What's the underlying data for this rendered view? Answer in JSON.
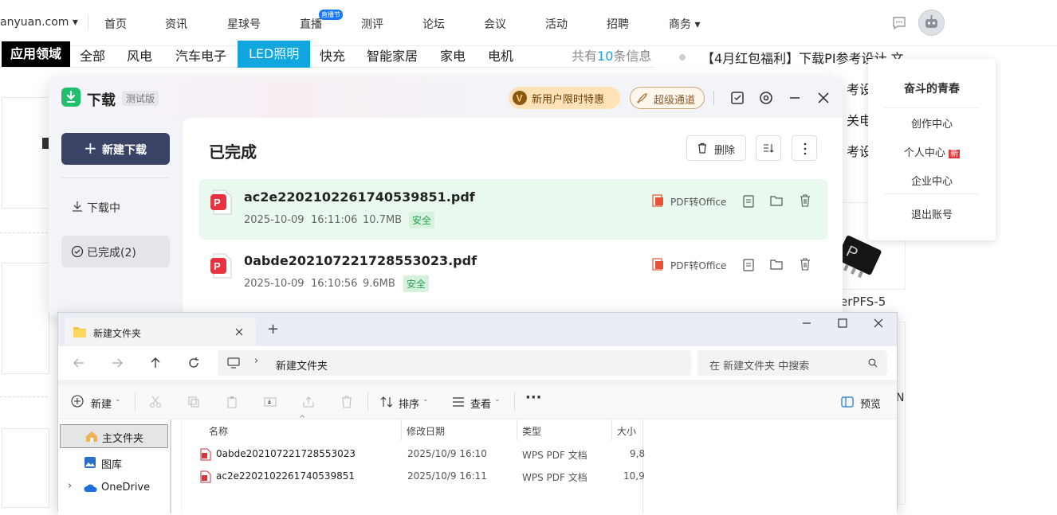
{
  "site": {
    "domain": "anyuan.com",
    "nav": [
      "首页",
      "资讯",
      "星球号",
      "直播",
      "测评",
      "论坛",
      "会议",
      "活动",
      "招聘",
      "商务"
    ],
    "live_badge": "直播节",
    "section_head": "应用领域",
    "categories": [
      "全部",
      "风电",
      "汽车电子",
      "LED照明",
      "快充",
      "智能家居",
      "家电",
      "电机"
    ],
    "selected_category": "LED照明",
    "count_prefix": "共有",
    "count_value": "10",
    "count_suffix": "条信息",
    "news": [
      "【4月红包福利】下载PI参考设计 文",
      "考设",
      "关电",
      "考设"
    ],
    "product_label": "erPFS-5",
    "edge_letter": "N"
  },
  "user_menu": {
    "username": "奋斗的青春",
    "items": [
      "创作中心",
      "个人中心",
      "企业中心",
      "退出账号"
    ],
    "new_badge": "新"
  },
  "downloader": {
    "title": "下载",
    "beta_tag": "测试版",
    "promo": "新用户限时特惠",
    "super_channel": "超级通道",
    "new_download": "新建下载",
    "side_downloading": "下载中",
    "side_completed": "已完成(2)",
    "heading": "已完成",
    "delete_label": "删除",
    "files": [
      {
        "name": "ac2e2202102261740539851.pdf",
        "date": "2025-10-09",
        "time": "16:11:06",
        "size": "10.7MB",
        "badge": "安全",
        "action": "PDF转Office"
      },
      {
        "name": "0abde202107221728553023.pdf",
        "date": "2025-10-09",
        "time": "16:10:56",
        "size": "9.6MB",
        "badge": "安全",
        "action": "PDF转Office"
      }
    ],
    "colors": {
      "accent": "#2e3a63",
      "highlight_row": "#e9f9ee",
      "safe": "#27a34f",
      "promo_bg": "#ffe2b7"
    }
  },
  "explorer": {
    "tab_title": "新建文件夹",
    "breadcrumb": "新建文件夹",
    "search_placeholder": "在 新建文件夹 中搜索",
    "cmd_new": "新建",
    "cmd_sort": "排序",
    "cmd_view": "查看",
    "cmd_preview": "预览",
    "nav_items": [
      "主文件夹",
      "图库",
      "OneDrive"
    ],
    "columns": [
      "名称",
      "修改日期",
      "类型",
      "大小"
    ],
    "rows": [
      {
        "name": "0abde202107221728553023",
        "date": "2025/10/9 16:10",
        "type": "WPS PDF 文档",
        "size": "9,8"
      },
      {
        "name": "ac2e2202102261740539851",
        "date": "2025/10/9 16:11",
        "type": "WPS PDF 文档",
        "size": "10,9"
      }
    ]
  }
}
